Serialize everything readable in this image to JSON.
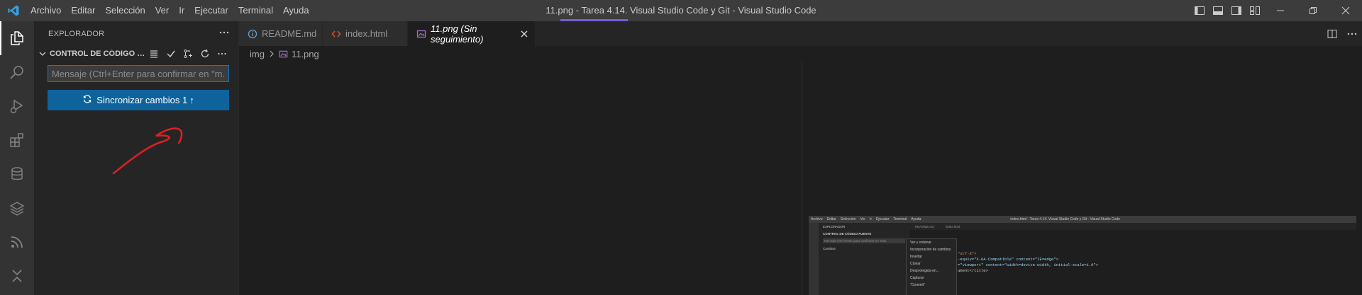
{
  "titlebar": {
    "menu": [
      "Archivo",
      "Editar",
      "Selección",
      "Ver",
      "Ir",
      "Ejecutar",
      "Terminal",
      "Ayuda"
    ],
    "title": "11.png - Tarea 4.14. Visual Studio Code y Git - Visual Studio Code"
  },
  "activitybar": {
    "items": [
      "explorer-icon",
      "search-icon",
      "run-debug-icon",
      "extensions-icon",
      "database-icon",
      "layers-icon",
      "rss-icon",
      "collapse-icon"
    ]
  },
  "sidebar": {
    "header": "EXPLORADOR",
    "section_title": "CONTROL DE CÓDIGO FUE...",
    "commit_placeholder": "Mensaje (Ctrl+Enter para confirmar en \"m...",
    "sync_label": "Sincronizar cambios 1",
    "sync_arrow": "↑"
  },
  "tabs": [
    {
      "label": "README.md",
      "icon": "info-icon"
    },
    {
      "label": "index.html",
      "icon": "html-icon"
    },
    {
      "label": "11.png (Sin seguimiento)",
      "icon": "image-icon",
      "active": true
    }
  ],
  "breadcrumb": {
    "folder": "img",
    "file": "11.png"
  },
  "preview": {
    "title": "index.html - Tarea 4.14. Visual Studio Code y Git - Visual Studio Code",
    "menu": [
      "Archivo",
      "Editar",
      "Selección",
      "Ver",
      "Ir",
      "Ejecutar",
      "Terminal",
      "Ayuda"
    ],
    "sidebar_header": "EXPLORADOR",
    "sidebar_section": "CONTROL DE CÓDIGO FUENTE",
    "sidebar_input": "Mensaje (Ctrl+Enter para confirmar en 'mas",
    "sidebar_changes": "Cambios",
    "tabs": [
      "README.md",
      "index.html"
    ],
    "context_menu": [
      "Ver y ordenar",
      "Incorporación de cambios",
      "Insertar",
      "Clonar",
      "Desprotegida en...",
      "Capturar",
      "\"Commit\""
    ],
    "code_lines": [
      "\"utf-8\">",
      "-equiv=\"X-UA-Compatible\" content=\"IE=edge\">",
      "=\"viewport\" content=\"width=device-width, initial-scale=1.0\">",
      "ument</title>"
    ]
  }
}
